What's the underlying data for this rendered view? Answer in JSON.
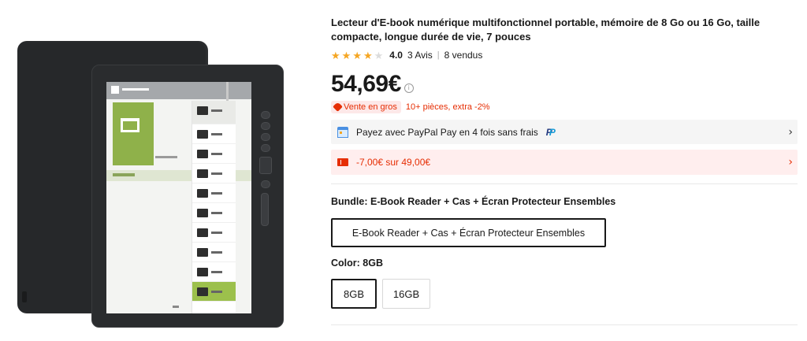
{
  "product": {
    "title": "Lecteur d'E-book numérique multifonctionnel portable, mémoire de 8 Go ou 16 Go, taille compacte, longue durée de vie, 7 pouces",
    "rating": "4.0",
    "rating_stars": 4,
    "reviews": "3 Avis",
    "separator": "|",
    "sold": "8 vendus",
    "price": "54,69€",
    "info_icon": "i",
    "wholesale_badge": "Vente en gros",
    "wholesale_text": "10+ pièces, extra -2%",
    "paypal_text": "Payez avec PayPal Pay en 4 fois sans frais",
    "paypal_logo": "P",
    "coupon_text": "-7,00€ sur 49,00€",
    "chevron": "›"
  },
  "bundle": {
    "label": "Bundle: E-Book Reader + Cas + Écran Protecteur Ensembles",
    "option": "E-Book Reader + Cas + Écran Protecteur Ensembles"
  },
  "color": {
    "label": "Color: 8GB",
    "options": [
      "8GB",
      "16GB"
    ],
    "selected": "8GB"
  },
  "icons": {
    "star": "star-icon",
    "info": "info-icon",
    "tag": "tag-icon",
    "calendar": "calendar-icon",
    "paypal": "paypal-logo",
    "coupon": "coupon-icon",
    "chevron": "chevron-right-icon"
  },
  "colors": {
    "accent_red": "#e62e04",
    "star": "#f5a623",
    "paypal_bg": "#f5f5f5",
    "coupon_bg": "#ffeeee",
    "device_green": "#8fb14a"
  }
}
